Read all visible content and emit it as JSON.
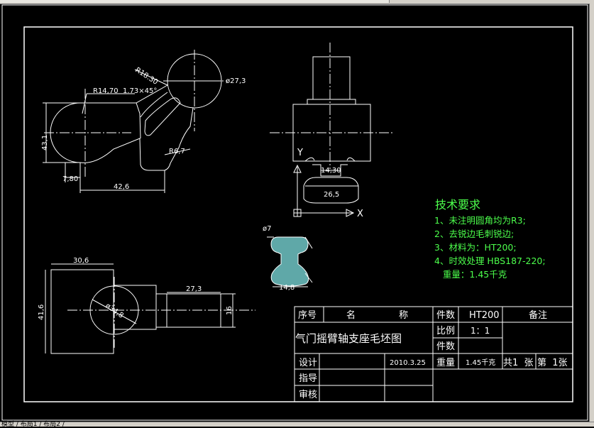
{
  "window": {
    "tabs_text": "模型 / 布局1 / 布局2 /"
  },
  "drawing": {
    "part1": {
      "radius_left": "R14,70",
      "chamfer": "1.73×45°",
      "radius_top": "R18.30",
      "diameter_boss": "ø27,3",
      "radius_inner": "R6,7",
      "height_left": "43,1",
      "small_height": "7,80",
      "width_bottom": "42,6"
    },
    "part2": {
      "axis_y": "Y",
      "axis_x": "X",
      "dim_inner": "14,30",
      "dim_outer": "26,5"
    },
    "part3": {
      "diameter_small": "ø7",
      "dim_bottom": "14,8"
    },
    "part4": {
      "top_width": "30,6",
      "height": "41,6",
      "boss_width": "27,3",
      "boss_height": "16",
      "diameter": "ø34,8"
    },
    "technical_requirements": {
      "title": "技术要求",
      "lines": [
        "1、未注明圆角均为R3;",
        "2、去锐边毛刺锐边;",
        "3、材料为：HT200;",
        "4、时效处理  HBS187-220;",
        "   重量：1.45千克"
      ]
    },
    "title_block": {
      "header": {
        "no": "序号",
        "name": "名",
        "title_char": "称",
        "qty": "件数",
        "material": "HT200",
        "remark": "备注"
      },
      "drawing_title": "气门摇臂轴支座毛坯图",
      "scale_label": "比例",
      "scale_value": "1：1",
      "count_label": "件数",
      "design_label": "设计",
      "date": "2010.3.25",
      "weight_label": "重量",
      "weight_value": "1.45千克",
      "sheets_total": "共1  张",
      "sheet_no": "第  1张",
      "guide_label": "指导",
      "review_label": "审核"
    }
  }
}
